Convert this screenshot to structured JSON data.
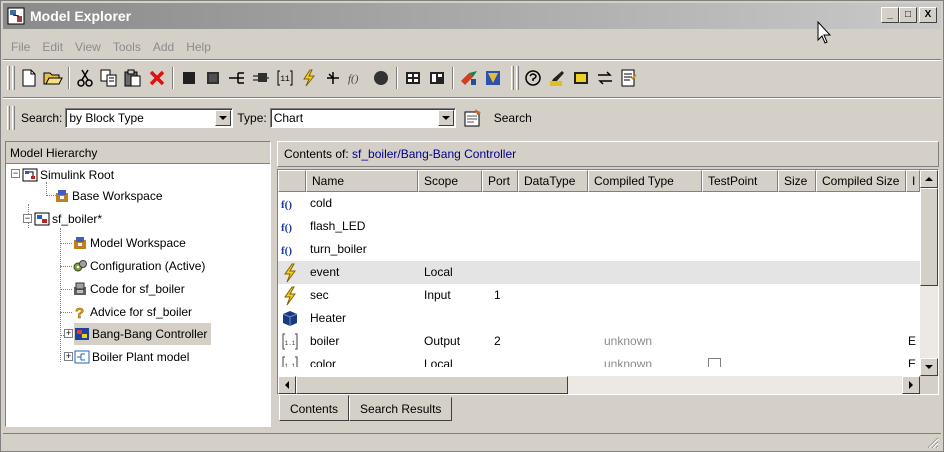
{
  "window": {
    "title": "Model Explorer",
    "controls": [
      "_",
      "□",
      "X"
    ]
  },
  "menu": [
    "File",
    "Edit",
    "View",
    "Tools",
    "Add",
    "Help"
  ],
  "toolbar": {
    "icons": [
      "new-icon",
      "open-icon",
      "cut-icon",
      "copy-icon",
      "paste-icon",
      "delete-icon",
      "block-icon",
      "block-alt-icon",
      "bus-icon",
      "subsystem-icon",
      "matrix-icon",
      "event-icon",
      "signal-icon",
      "function-icon",
      "stop-icon",
      "table-icon",
      "table-alt-icon",
      "chart-icon",
      "fav-icon",
      "help-icon",
      "highlight-icon",
      "box-icon",
      "swap-icon",
      "notes-icon"
    ]
  },
  "search": {
    "search_label": "Search:",
    "search_by": "by Block Type",
    "type_label": "Type:",
    "type_value": "Chart",
    "search_button": "Search"
  },
  "hierarchy": {
    "header": "Model Hierarchy",
    "items": [
      {
        "label": "Simulink Root"
      },
      {
        "label": "Base Workspace"
      },
      {
        "label": "sf_boiler*"
      },
      {
        "label": "Model Workspace"
      },
      {
        "label": "Configuration (Active)"
      },
      {
        "label": "Code for sf_boiler"
      },
      {
        "label": "Advice for sf_boiler"
      },
      {
        "label": "Bang-Bang Controller"
      },
      {
        "label": "Boiler Plant model"
      }
    ]
  },
  "contents": {
    "header_prefix": "Contents of: ",
    "path": "sf_boiler/Bang-Bang Controller",
    "columns": [
      "Name",
      "Scope",
      "Port",
      "DataType",
      "Compiled Type",
      "TestPoint",
      "Size",
      "Compiled Size",
      "I"
    ],
    "rows": [
      {
        "icon": "function-icon",
        "name": "cold",
        "scope": "",
        "port": "",
        "compiled_type": "",
        "extra": ""
      },
      {
        "icon": "function-icon",
        "name": "flash_LED",
        "scope": "",
        "port": "",
        "compiled_type": "",
        "extra": ""
      },
      {
        "icon": "function-icon",
        "name": "turn_boiler",
        "scope": "",
        "port": "",
        "compiled_type": "",
        "extra": ""
      },
      {
        "icon": "event-icon",
        "name": "event",
        "scope": "Local",
        "port": "",
        "compiled_type": "",
        "extra": ""
      },
      {
        "icon": "event-icon",
        "name": "sec",
        "scope": "Input",
        "port": "1",
        "compiled_type": "",
        "extra": ""
      },
      {
        "icon": "box-icon",
        "name": "Heater",
        "scope": "",
        "port": "",
        "compiled_type": "",
        "extra": ""
      },
      {
        "icon": "data-icon",
        "name": "boiler",
        "scope": "Output",
        "port": "2",
        "compiled_type": "unknown",
        "extra": "E"
      },
      {
        "icon": "data-icon",
        "name": "color",
        "scope": "Local",
        "port": "",
        "compiled_type": "unknown",
        "extra": "E"
      }
    ]
  },
  "tabs": [
    "Contents",
    "Search Results"
  ]
}
